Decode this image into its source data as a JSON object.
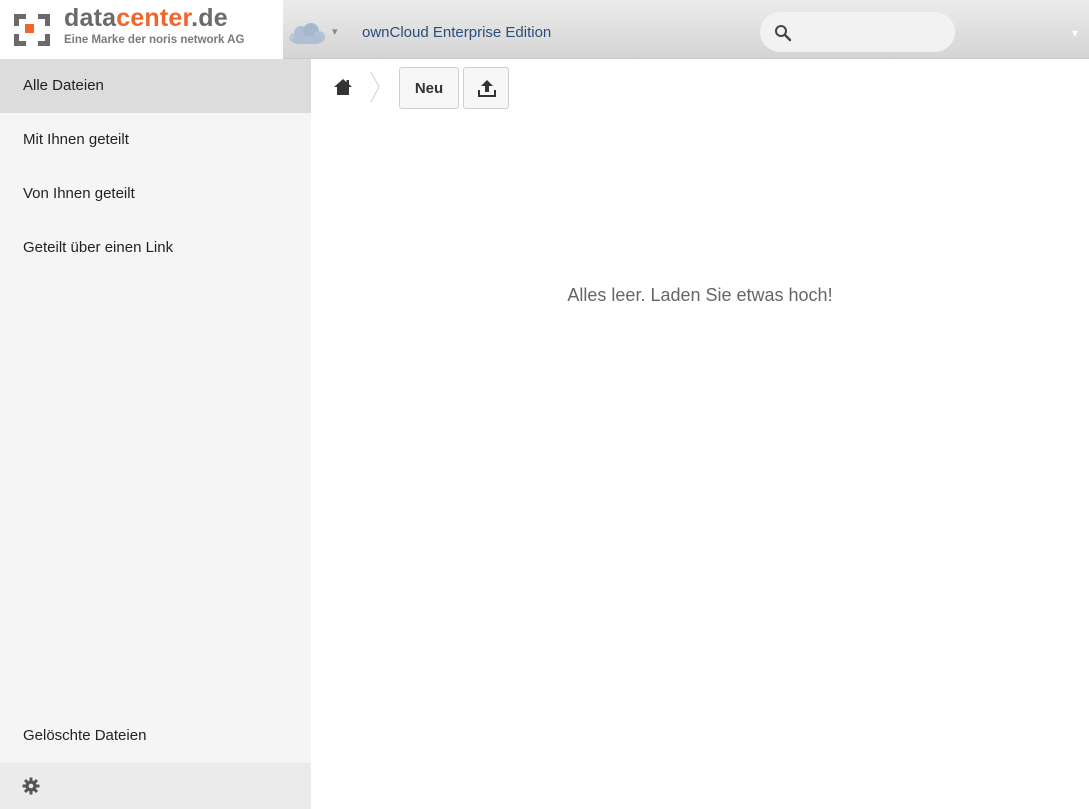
{
  "header": {
    "brand": {
      "part1": "data",
      "part2": "center",
      "part3": ".de"
    },
    "tagline": "Eine Marke der noris network AG",
    "app_title": "ownCloud Enterprise Edition",
    "search": {
      "value": "",
      "placeholder": ""
    },
    "icons": {
      "logo": "datacenter-logo-mark",
      "cloud": "owncloud-cloud-icon",
      "app_caret": "caret-down-icon",
      "search": "search-icon",
      "user_caret": "caret-down-icon"
    },
    "caret_glyph": "▾"
  },
  "sidebar": {
    "items": [
      {
        "label": "Alle Dateien",
        "active": true
      },
      {
        "label": "Mit Ihnen geteilt",
        "active": false
      },
      {
        "label": "Von Ihnen geteilt",
        "active": false
      },
      {
        "label": "Geteilt über einen Link",
        "active": false
      }
    ],
    "deleted_files_label": "Gelöschte Dateien",
    "settings_icon": "gear-icon"
  },
  "toolbar": {
    "home_icon": "home-icon",
    "new_label": "Neu",
    "upload_icon": "upload-icon"
  },
  "content": {
    "empty_message": "Alles leer. Laden Sie etwas hoch!"
  },
  "colors": {
    "brand_orange": "#f0652b",
    "brand_gray": "#6a6a6a",
    "link_blue": "#2a4d7a",
    "sidebar_bg": "#f5f5f5",
    "sidebar_active": "#dcdcdc"
  }
}
